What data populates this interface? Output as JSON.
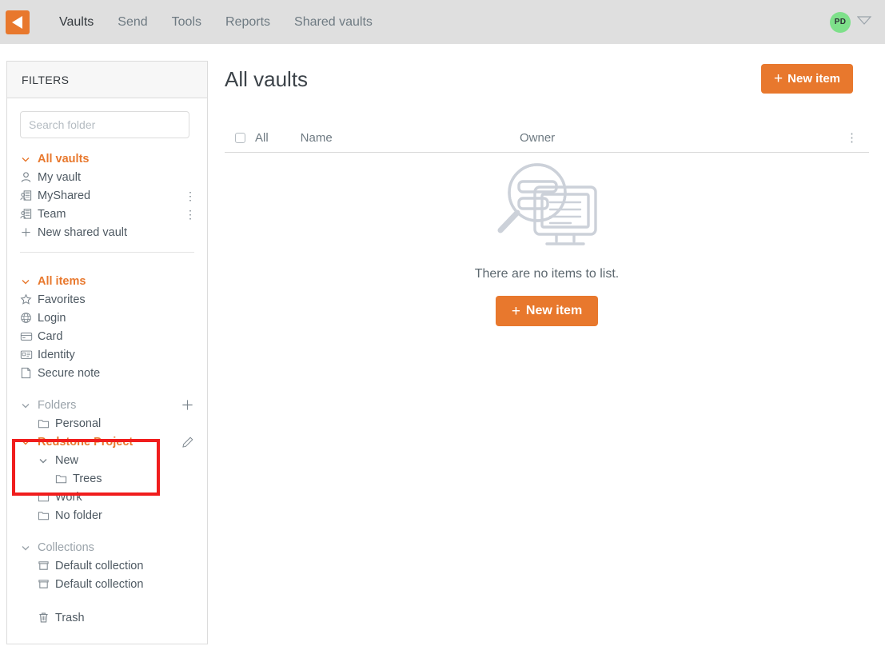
{
  "topnav": {
    "logo_name": "app-logo",
    "items": [
      {
        "label": "Vaults",
        "active": true
      },
      {
        "label": "Send",
        "active": false
      },
      {
        "label": "Tools",
        "active": false
      },
      {
        "label": "Reports",
        "active": false
      },
      {
        "label": "Shared vaults",
        "active": false
      }
    ],
    "avatar_initials": "PD"
  },
  "sidebar": {
    "header": "FILTERS",
    "search_placeholder": "Search folder",
    "search_value": "",
    "vaults": {
      "head": "All vaults",
      "items": [
        {
          "label": "My vault",
          "icon": "person-icon",
          "menu": false
        },
        {
          "label": "MyShared",
          "icon": "shared-vault-icon",
          "menu": true
        },
        {
          "label": "Team",
          "icon": "shared-vault-icon",
          "menu": true
        },
        {
          "label": "New shared vault",
          "icon": "plus-icon",
          "menu": false
        }
      ]
    },
    "items": {
      "head": "All items",
      "entries": [
        {
          "label": "Favorites",
          "icon": "star-icon"
        },
        {
          "label": "Login",
          "icon": "globe-icon"
        },
        {
          "label": "Card",
          "icon": "credit-card-icon"
        },
        {
          "label": "Identity",
          "icon": "id-card-icon"
        },
        {
          "label": "Secure note",
          "icon": "note-icon"
        }
      ]
    },
    "folders": {
      "head": "Folders",
      "add_icon": "plus-icon",
      "entries": [
        {
          "label": "Personal",
          "icon": "folder-icon"
        },
        {
          "label": "Redstone Project",
          "icon": "chevron-down-icon",
          "accent": true,
          "edit_icon": "pencil-icon"
        },
        {
          "label": "New",
          "icon": "chevron-down-icon"
        },
        {
          "label": "Trees",
          "icon": "folder-icon"
        },
        {
          "label": "Work",
          "icon": "folder-icon"
        },
        {
          "label": "No folder",
          "icon": "folder-icon"
        }
      ]
    },
    "collections": {
      "head": "Collections",
      "entries": [
        {
          "label": "Default collection",
          "icon": "collection-icon"
        },
        {
          "label": "Default collection",
          "icon": "collection-icon"
        }
      ]
    },
    "trash": {
      "label": "Trash",
      "icon": "trash-icon"
    }
  },
  "main": {
    "title": "All vaults",
    "new_item_top": "New item",
    "table": {
      "select_all_label": "All",
      "columns": [
        "Name",
        "Owner"
      ]
    },
    "empty": {
      "message": "There are no items to list.",
      "new_item_label": "New item",
      "illustration": "search-screen-illustration"
    }
  },
  "colors": {
    "accent": "#e8782d",
    "highlight": "#f01d1d",
    "avatar_bg": "#7ee08a",
    "topbar_bg": "#dfdfdf"
  }
}
